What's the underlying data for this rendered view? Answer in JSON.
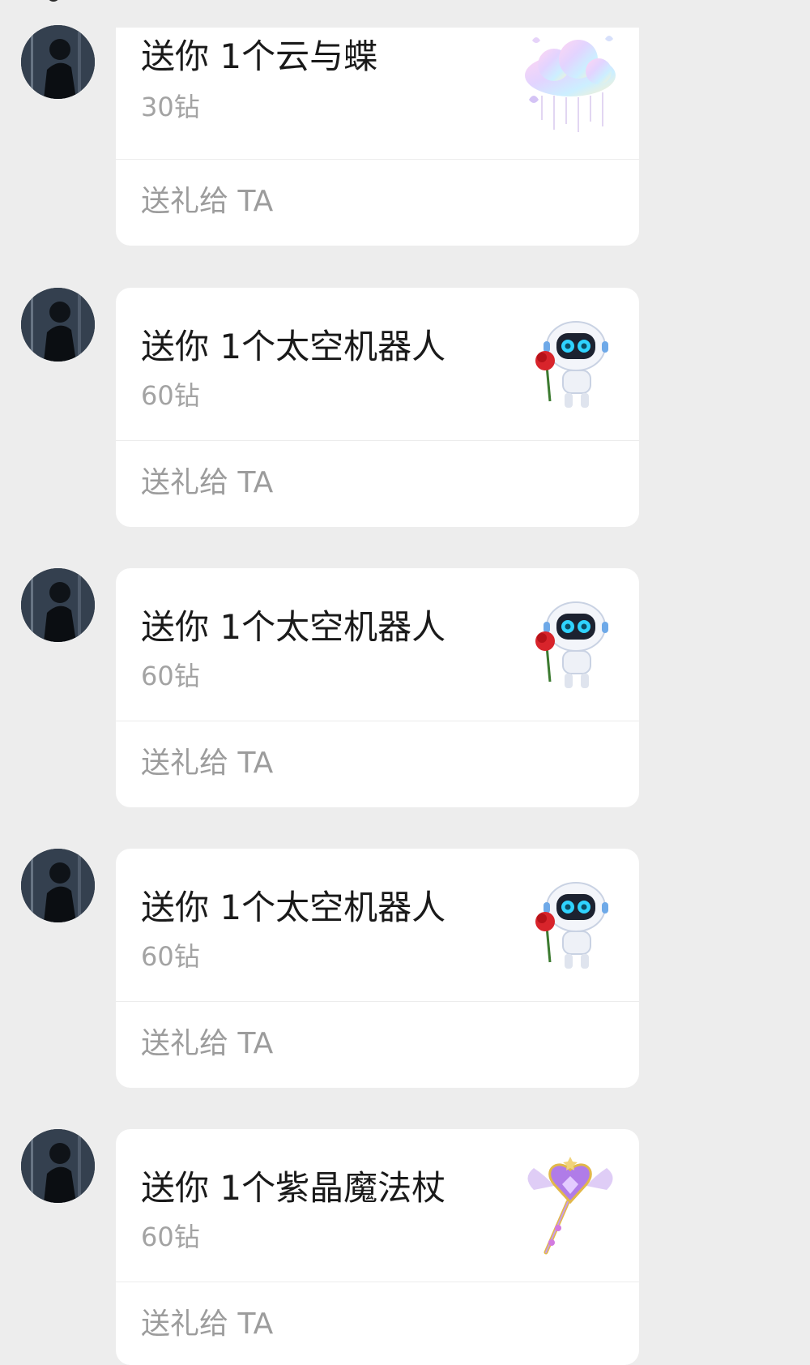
{
  "messages": [
    {
      "title": "送你 1个云与蝶",
      "price": "30钻",
      "action": "送礼给 TA",
      "gift_icon": "cloud-butterfly-icon"
    },
    {
      "title": "送你 1个太空机器人",
      "price": "60钻",
      "action": "送礼给 TA",
      "gift_icon": "space-robot-icon"
    },
    {
      "title": "送你 1个太空机器人",
      "price": "60钻",
      "action": "送礼给 TA",
      "gift_icon": "space-robot-icon"
    },
    {
      "title": "送你 1个太空机器人",
      "price": "60钻",
      "action": "送礼给 TA",
      "gift_icon": "space-robot-icon"
    },
    {
      "title": "送你 1个紫晶魔法杖",
      "price": "60钻",
      "action": "送礼给 TA",
      "gift_icon": "amethyst-wand-icon"
    }
  ],
  "colors": {
    "page_background": "#ededed",
    "card_background": "#ffffff",
    "title_text": "#1a1a1a",
    "secondary_text": "#a3a3a3"
  }
}
